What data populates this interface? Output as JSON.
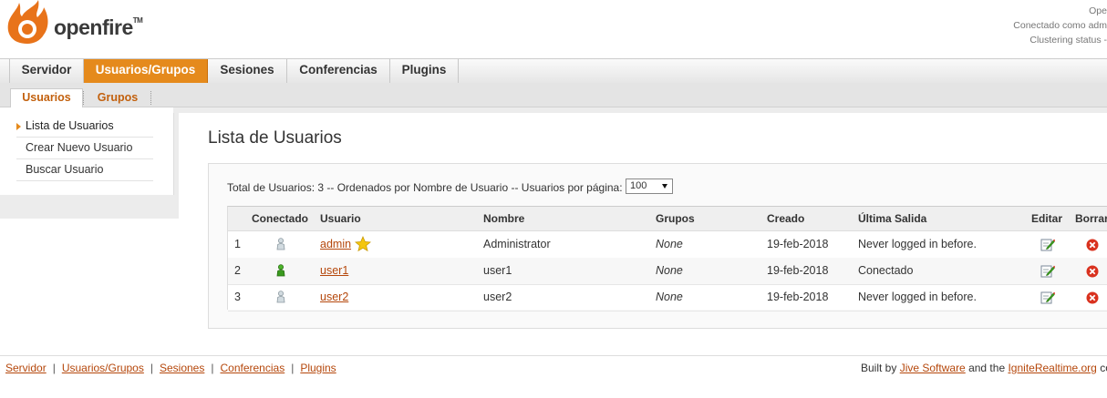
{
  "header": {
    "logo_text": "openfire",
    "logo_tm": "TM",
    "info_line1": "Ope",
    "info_line2": "Conectado como adm",
    "info_line3": "Clustering status -"
  },
  "main_nav": [
    {
      "label": "Servidor",
      "active": false
    },
    {
      "label": "Usuarios/Grupos",
      "active": true
    },
    {
      "label": "Sesiones",
      "active": false
    },
    {
      "label": "Conferencias",
      "active": false
    },
    {
      "label": "Plugins",
      "active": false
    }
  ],
  "sub_nav": [
    {
      "label": "Usuarios",
      "active": true
    },
    {
      "label": "Grupos",
      "active": false
    }
  ],
  "sidebar": {
    "items": [
      {
        "label": "Lista de Usuarios",
        "active": true
      },
      {
        "label": "Crear Nuevo Usuario",
        "active": false
      },
      {
        "label": "Buscar Usuario",
        "active": false
      }
    ]
  },
  "page": {
    "title": "Lista de Usuarios",
    "summary": "Total de Usuarios: 3 -- Ordenados por Nombre de Usuario -- Usuarios por página:",
    "per_page_value": "100"
  },
  "table": {
    "columns": [
      "Conectado",
      "Usuario",
      "Nombre",
      "Grupos",
      "Creado",
      "Última Salida",
      "Editar",
      "Borrar"
    ],
    "rows": [
      {
        "index": "1",
        "online": false,
        "username": "admin",
        "is_admin": true,
        "name": "Administrator",
        "groups": "None",
        "created": "19-feb-2018",
        "last_logout": "Never logged in before."
      },
      {
        "index": "2",
        "online": true,
        "username": "user1",
        "is_admin": false,
        "name": "user1",
        "groups": "None",
        "created": "19-feb-2018",
        "last_logout": "Conectado"
      },
      {
        "index": "3",
        "online": false,
        "username": "user2",
        "is_admin": false,
        "name": "user2",
        "groups": "None",
        "created": "19-feb-2018",
        "last_logout": "Never logged in before."
      }
    ]
  },
  "footer": {
    "links": [
      "Servidor",
      "Usuarios/Grupos",
      "Sesiones",
      "Conferencias",
      "Plugins"
    ],
    "built_by_prefix": "Built by",
    "jive_link": "Jive Software",
    "and_the": "and the",
    "ignite_link": "IgniteRealtime.org",
    "tail": "co"
  },
  "colors": {
    "accent_orange": "#e58a1c",
    "link": "#b5470b",
    "online_green": "#3a9a1e",
    "offline_gray": "#b9c3c9",
    "delete_red": "#d9311e",
    "star_yellow": "#f4c60f"
  }
}
